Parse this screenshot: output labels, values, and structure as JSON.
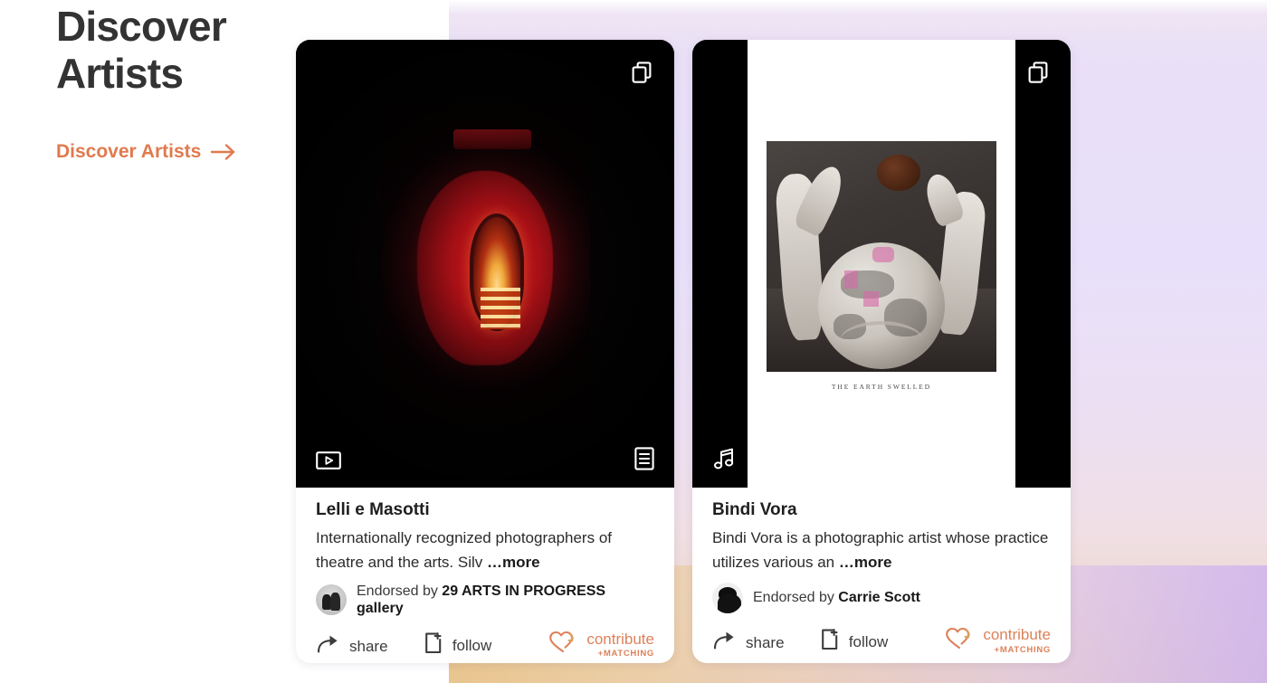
{
  "page": {
    "title": "Discover\nArtists",
    "discover_link_label": "Discover Artists",
    "arrow_icon": "arrow-right-icon",
    "accent_color": "#e07a4e",
    "contribute_color": "#dd8159",
    "background_top_color": "#e8e0fa",
    "background_bottom_left_color": "#e9c48c",
    "background_bottom_right_color": "#ceb4ee"
  },
  "cards": [
    {
      "artist_name": "Lelli e Masotti",
      "bio": "Internationally recognized photographers of theatre and the arts. Silv",
      "more_label": "…more",
      "endorsed_prefix": "Endorsed by",
      "endorsed_by": "29 ARTS IN PROGRESS gallery",
      "avatar_icon": "avatar",
      "media": {
        "background": "#000000",
        "top_right_icon": "copy-icon",
        "bottom_left_icon": "video-icon",
        "bottom_right_icon": "document-icon",
        "caption": ""
      },
      "actions": {
        "share_label": "share",
        "share_icon": "share-icon",
        "follow_label": "follow",
        "follow_icon": "follow-page-plus-icon",
        "contribute_label": "contribute",
        "contribute_sub_label": "+MATCHING",
        "contribute_icon": "heart-arrow-icon"
      }
    },
    {
      "artist_name": "Bindi Vora",
      "bio": "Bindi Vora is a photographic artist whose practice utilizes various an",
      "more_label": "…more",
      "endorsed_prefix": "Endorsed by",
      "endorsed_by": "Carrie Scott",
      "avatar_icon": "avatar",
      "media": {
        "background": "#ffffff",
        "top_right_icon": "copy-icon",
        "bottom_left_icon": "music-note-icon",
        "bottom_right_icon": "",
        "caption": "THE EARTH SWELLED"
      },
      "actions": {
        "share_label": "share",
        "share_icon": "share-icon",
        "follow_label": "follow",
        "follow_icon": "follow-page-plus-icon",
        "contribute_label": "contribute",
        "contribute_sub_label": "+MATCHING",
        "contribute_icon": "heart-arrow-icon"
      }
    }
  ]
}
